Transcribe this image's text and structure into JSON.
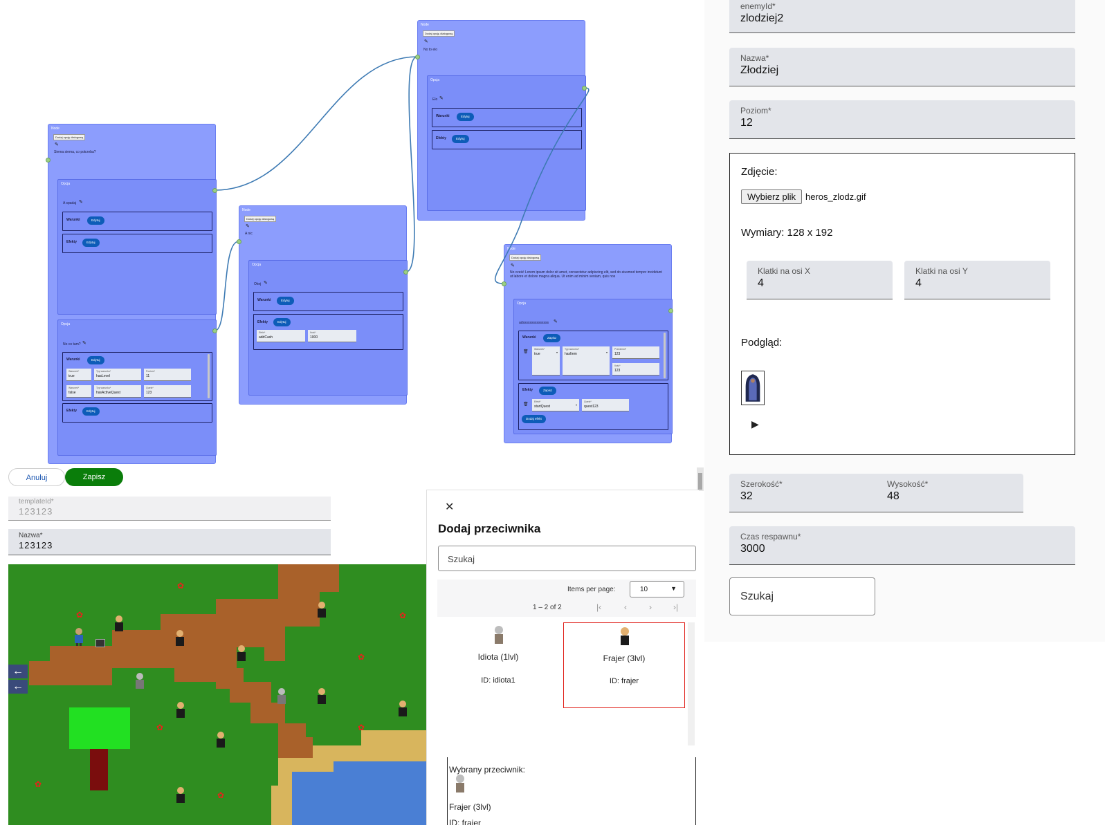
{
  "node_editor": {
    "node_title": "Node",
    "option_title": "Opcja",
    "add_dialogue_btn": "Dodaj opcję dialogową",
    "conditions_title": "Warunki",
    "effects_title": "Efekty",
    "edit_btn": "Edytuj",
    "save_btn": "Zapisz",
    "add_effect_btn": "Dodaj efekt",
    "node1": {
      "text": "Siema siema, co potrzeba?",
      "option1": {
        "text": "A spadaj"
      },
      "option2": {
        "text": "No co tam?",
        "conditions": [
          {
            "warunek_label": "Warunek*",
            "warunek": "true",
            "typ_label": "Typ warunku*",
            "typ": "hasLevel",
            "param_label": "Poziom*",
            "param": "11"
          },
          {
            "warunek_label": "Warunek*",
            "warunek": "false",
            "typ_label": "Typ warunku*",
            "typ": "hasActiveQuest",
            "param_label": "Quest*",
            "param": "123"
          }
        ]
      }
    },
    "node2": {
      "text": "A nic",
      "option1": {
        "text": "Okej",
        "effect": {
          "efekt_label": "Efekt*",
          "efekt": "addCash",
          "param_label": "Ilość*",
          "param": "1000"
        }
      }
    },
    "node3": {
      "text": "No to elo",
      "option1": {
        "text": "Elo"
      }
    },
    "node4": {
      "text": "No cześć Lorem ipsum dolor sit amet, consectetur adipiscing elit, sed do eiusmod tempor incididunt ut labore et dolore magna aliqua. Ut enim ad minim veniam, quis nos",
      "option1": {
        "text": "adsssssssssssssss",
        "condition": {
          "warunek_label": "Warunek*",
          "warunek": "true",
          "typ_label": "Typ warunku*",
          "typ": "hasItem",
          "p1_label": "Przedmiot*",
          "p1": "123",
          "p2_label": "Ilość*",
          "p2": "123"
        },
        "effect": {
          "efekt_label": "Efekt*",
          "efekt": "startQuest",
          "param_label": "Quest*",
          "param": "quest123"
        }
      }
    }
  },
  "map_form": {
    "cancel_btn": "Anuluj",
    "save_btn": "Zapisz",
    "template_id": {
      "label": "templateId*",
      "value": "123123"
    },
    "name": {
      "label": "Nazwa*",
      "value": "123123"
    }
  },
  "enemy_dialog": {
    "title": "Dodaj przeciwnika",
    "search_placeholder": "Szukaj",
    "items_per_page_label": "Items per page:",
    "items_per_page_value": "10",
    "range_label": "1 – 2 of 2",
    "nav": {
      "first": "|‹",
      "prev": "‹",
      "next": "›",
      "last": "›|"
    },
    "enemies": [
      {
        "name": "Idiota (1lvl)",
        "id": "ID: idiota1",
        "selected": false
      },
      {
        "name": "Frajer (3lvl)",
        "id": "ID: frajer",
        "selected": true
      }
    ],
    "selected_label": "Wybrany przeciwnik:",
    "selected_name": "Frajer (3lvl)",
    "selected_id": "ID: frajer"
  },
  "enemy_form": {
    "enemy_id": {
      "label": "enemyId*",
      "value": "zlodziej2"
    },
    "name": {
      "label": "Nazwa*",
      "value": "Złodziej"
    },
    "level": {
      "label": "Poziom*",
      "value": "12"
    },
    "photo_label": "Zdjęcie:",
    "choose_file_btn": "Wybierz plik",
    "file_name": "heros_zlodz.gif",
    "dimensions": "Wymiary: 128 x 192",
    "frames_x": {
      "label": "Klatki na osi X",
      "value": "4"
    },
    "frames_y": {
      "label": "Klatki na osi Y",
      "value": "4"
    },
    "preview_label": "Podgląd:",
    "width": {
      "label": "Szerokość*",
      "value": "32"
    },
    "height": {
      "label": "Wysokość*",
      "value": "48"
    },
    "respawn": {
      "label": "Czas respawnu*",
      "value": "3000"
    },
    "search_placeholder": "Szukaj"
  },
  "colors": {
    "node_bg": "#8c9dfd",
    "option_bg": "#7b8ef9",
    "edit_button": "#0d5cb8",
    "save_green": "#0a7d0a",
    "selected_card_border": "#e0201a",
    "edge": "#3d7ab3"
  }
}
